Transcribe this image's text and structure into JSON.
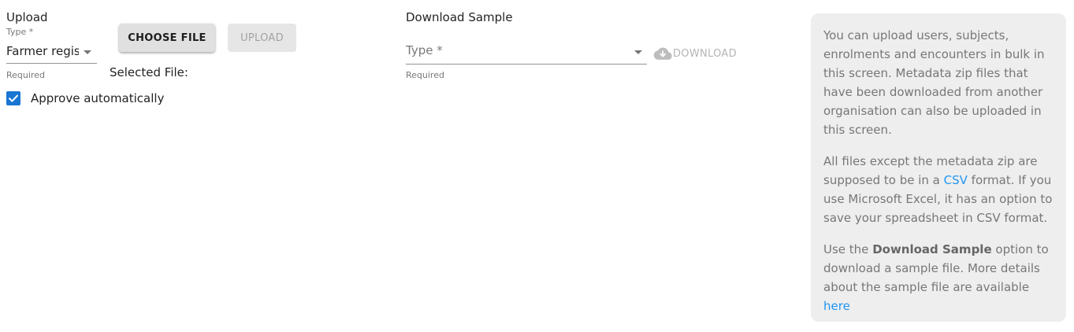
{
  "upload": {
    "title": "Upload",
    "type_label": "Type *",
    "type_value": "Farmer regis",
    "helper": "Required",
    "choose_file_label": "CHOOSE FILE",
    "upload_label": "UPLOAD",
    "selected_file_label": "Selected File:",
    "approve_label": "Approve automatically",
    "approve_checked": true
  },
  "download": {
    "title": "Download Sample",
    "type_placeholder": "Type *",
    "helper": "Required",
    "download_label": "DOWNLOAD"
  },
  "info": {
    "p1": "You can upload users, subjects, enrolments and encounters in bulk in this screen. Metadata zip files that have been downloaded from another organisation can also be uploaded in this screen.",
    "p2_before": "All files except the metadata zip are supposed to be in a ",
    "p2_link": "CSV",
    "p2_after": " format. If you use Microsoft Excel, it has an option to save your spreadsheet in CSV format.",
    "p3_before": "Use the ",
    "p3_bold": "Download Sample",
    "p3_middle": " option to download a sample file. More details about the sample file are available ",
    "p3_link": "here"
  },
  "colors": {
    "primary": "#1976d2",
    "link": "#2196f3",
    "panel_bg": "#eeeeee",
    "panel_text": "#777777"
  }
}
